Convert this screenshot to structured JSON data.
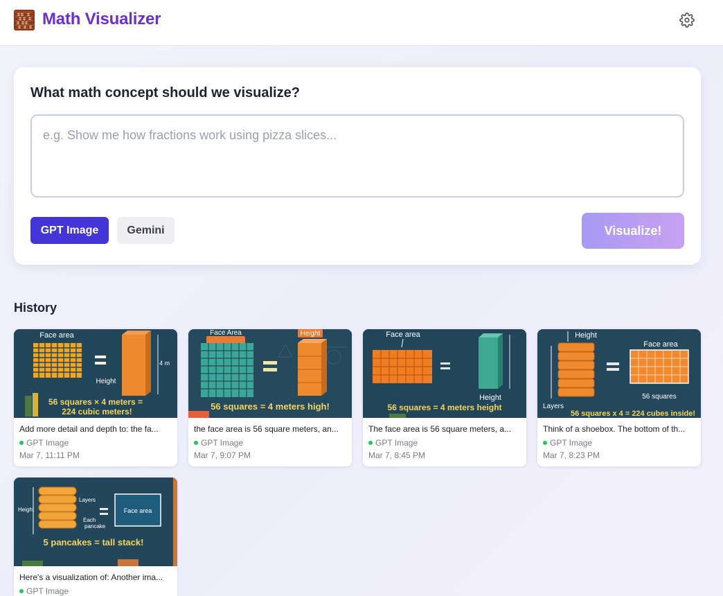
{
  "header": {
    "title": "Math Visualizer",
    "logo_icon": "abacus-icon",
    "settings_icon": "gear-icon",
    "title_color": "#6a2ed1"
  },
  "composer": {
    "title": "What math concept should we visualize?",
    "placeholder": "e.g. Show me how fractions work using pizza slices...",
    "value": "",
    "models": [
      {
        "label": "GPT Image",
        "selected": true
      },
      {
        "label": "Gemini",
        "selected": false
      }
    ],
    "submit_label": "Visualize!",
    "accent": "#4435d7"
  },
  "history": {
    "title": "History",
    "items": [
      {
        "text": "Add more detail and depth to: the fa...",
        "model": "GPT Image",
        "date": "Mar 7, 11:11 PM",
        "thumb": {
          "top": "Face area",
          "side": "4 m",
          "mid": "Height",
          "caption1": "56 squares × 4 meters =",
          "caption2": "224 cubic meters!"
        }
      },
      {
        "text": "the face area is 56 square meters, an...",
        "model": "GPT Image",
        "date": "Mar 7, 9:07 PM",
        "thumb": {
          "top": "Face Area",
          "side": "Height",
          "caption1": "56 squares = 4 meters high!"
        }
      },
      {
        "text": "The face area is 56 square meters, a...",
        "model": "GPT Image",
        "date": "Mar 7, 8:45 PM",
        "thumb": {
          "top": "Face area",
          "side": "Height",
          "caption1": "56 squares = 4 meters height"
        }
      },
      {
        "text": "Think of a shoebox. The bottom of th...",
        "model": "GPT Image",
        "date": "Mar 7, 8:23 PM",
        "thumb": {
          "top": "Height",
          "right": "Face area",
          "side": "Layers",
          "mid": "56 squares",
          "caption1": "56 squares x 4 = 224 cubes inside!"
        }
      },
      {
        "text": "Here's a visualization of: Another ima...",
        "model": "GPT Image",
        "date": "",
        "thumb": {
          "top": "Layers",
          "side": "Height",
          "right": "Face area",
          "mid1": "Each",
          "mid2": "pancake",
          "caption1": "5 pancakes = tall stack!"
        }
      }
    ]
  }
}
